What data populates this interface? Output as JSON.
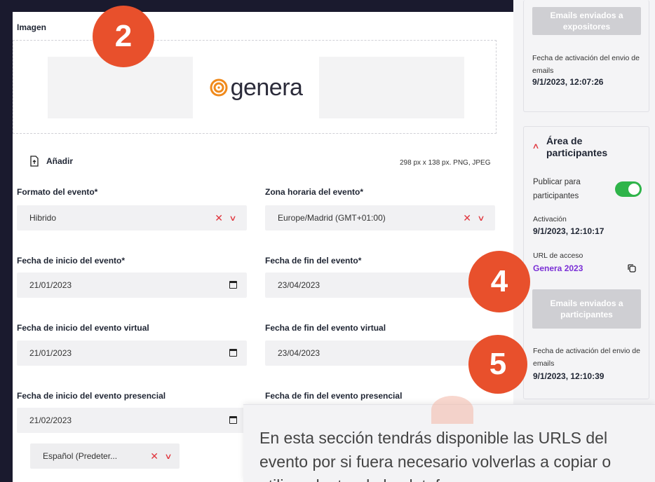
{
  "image_section": {
    "title": "Imagen",
    "logo_text": "genera",
    "add_label": "Añadir",
    "hint": "298 px x 138 px.  PNG, JPEG"
  },
  "badges": [
    "2",
    "4",
    "5"
  ],
  "form": {
    "format_label": "Formato del evento*",
    "format_value": "Hibrido",
    "timezone_label": "Zona horaria del evento*",
    "timezone_value": "Europe/Madrid (GMT+01:00)",
    "start_label": "Fecha de inicio del evento*",
    "start_value": "21/01/2023",
    "end_label": "Fecha de fin del evento*",
    "end_value": "23/04/2023",
    "virtual_start_label": "Fecha de inicio del evento virtual",
    "virtual_start_value": "21/01/2023",
    "virtual_end_label": "Fecha de fin del evento virtual",
    "virtual_end_value": "23/04/2023",
    "presencial_start_label": "Fecha de inicio del evento presencial",
    "presencial_start_value": "21/02/2023",
    "presencial_end_label": "Fecha de fin del evento presencial",
    "language_value": "Español (Predeter..."
  },
  "sidebar": {
    "exhibitors_button": "Emails enviados a expositores",
    "exhibitors_activation_label": "Fecha de activación del envio de emails",
    "exhibitors_activation_value": "9/1/2023, 12:07:26",
    "participants_title": "Área de participantes",
    "publish_label": "Publicar para participantes",
    "activation_label": "Activación",
    "activation_value": "9/1/2023, 12:10:17",
    "url_label": "URL de acceso",
    "url_value": "Genera 2023",
    "participants_button": "Emails enviados a participantes",
    "participants_activation_label": "Fecha de activación del envio de emails",
    "participants_activation_value": "9/1/2023, 12:10:39"
  },
  "tooltip": {
    "text": "En esta sección tendrás disponible las URLS del evento por si fuera necesario volverlas a copiar o utilizar dentro de la plataforma."
  },
  "colors": {
    "accent": "#e0343c",
    "badge": "#e8502c",
    "toggle_on": "#2fb44a",
    "link": "#7a2fd6"
  }
}
